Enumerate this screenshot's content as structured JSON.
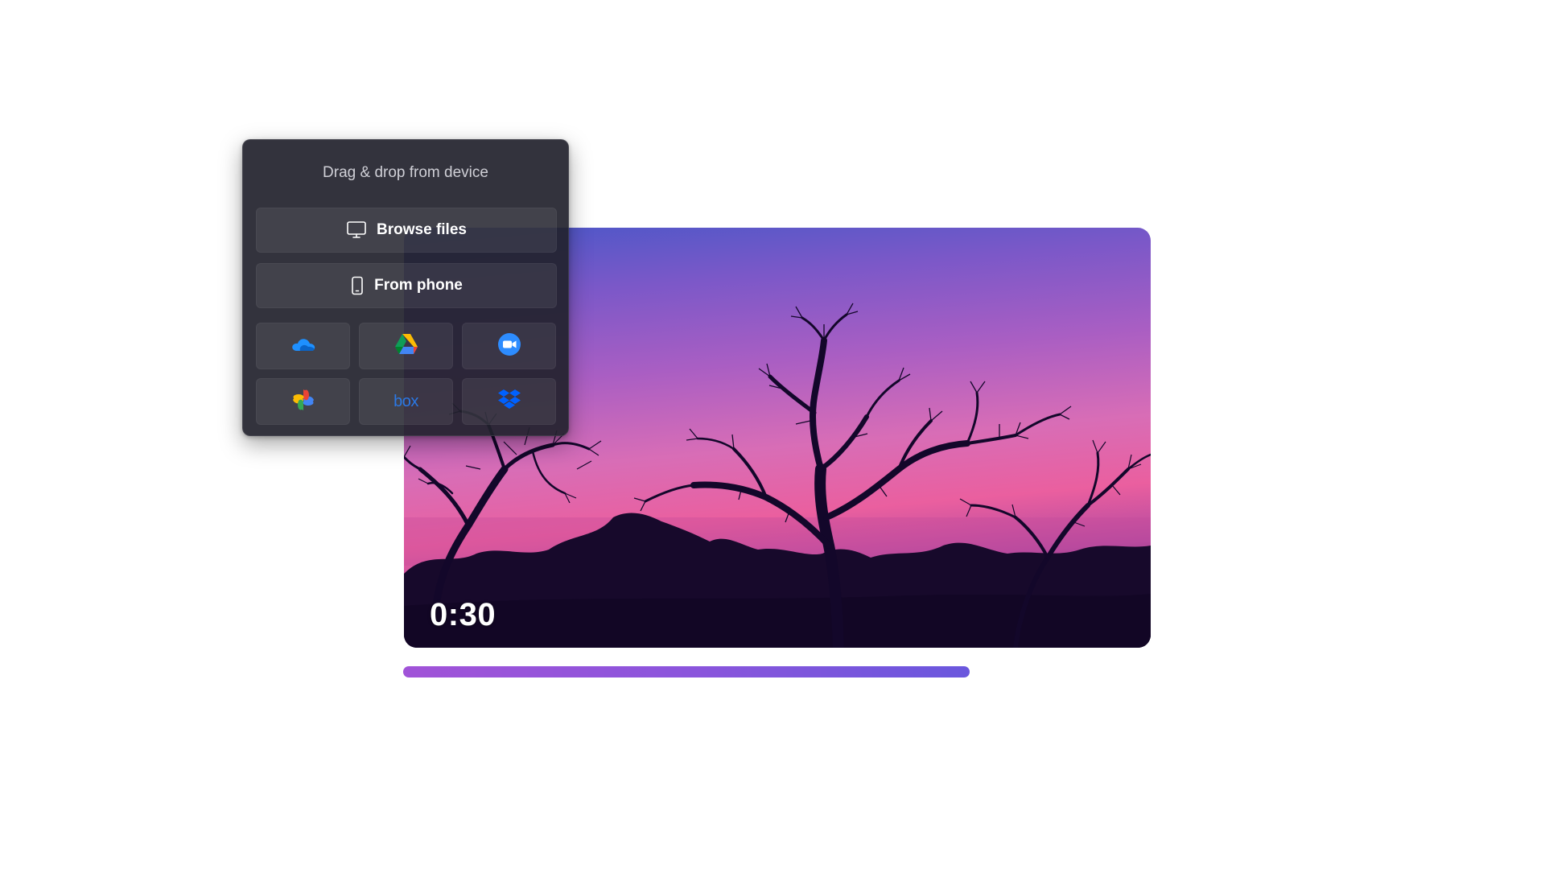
{
  "video": {
    "timestamp": "0:30",
    "progress_fraction": 0.61
  },
  "upload_panel": {
    "title": "Drag & drop from device",
    "browse_label": "Browse files",
    "phone_label": "From phone",
    "sources": [
      {
        "name": "onedrive-icon"
      },
      {
        "name": "google-drive-icon"
      },
      {
        "name": "zoom-icon"
      },
      {
        "name": "google-photos-icon"
      },
      {
        "name": "box-icon",
        "text": "box"
      },
      {
        "name": "dropbox-icon"
      }
    ]
  },
  "colors": {
    "panel_bg": "#22222c",
    "progress_start": "#a153d8",
    "progress_end": "#6a57dd",
    "box_blue": "#2b78e4",
    "dropbox_blue": "#0061fe",
    "zoom_blue": "#2d8cff"
  }
}
